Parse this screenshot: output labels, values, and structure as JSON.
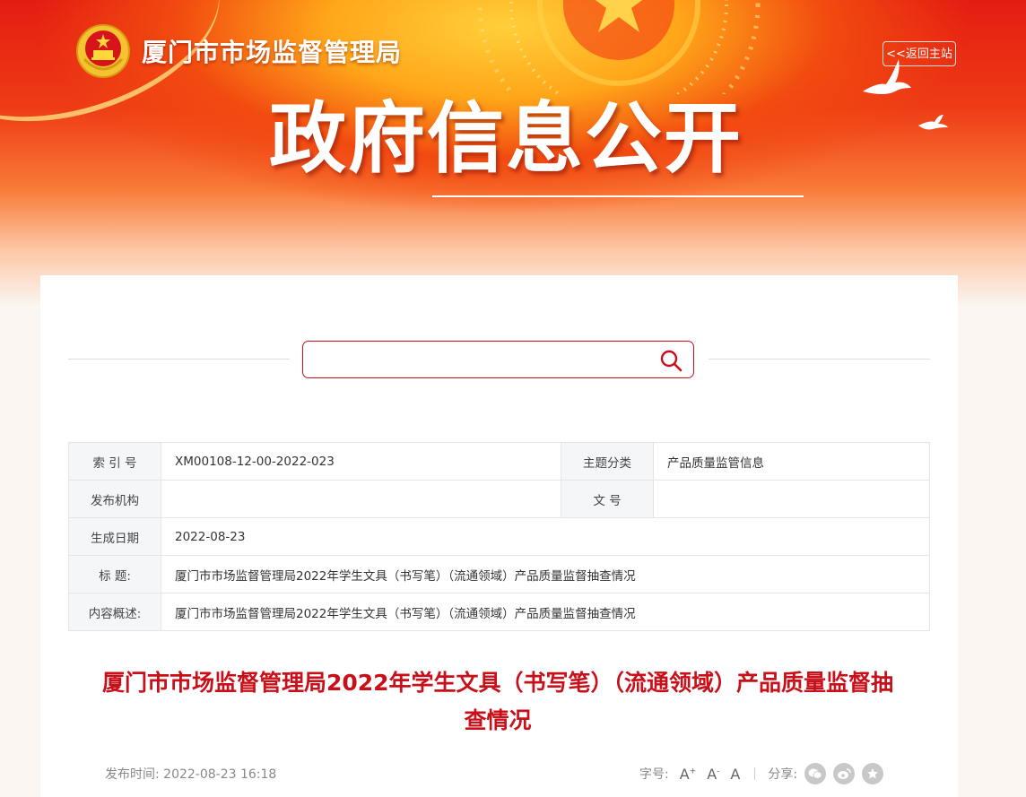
{
  "header": {
    "site_name": "厦门市市场监督管理局",
    "back_link": "<<返回主站",
    "hero_title": "政府信息公开"
  },
  "search": {
    "placeholder": ""
  },
  "info_table": {
    "index_label": "索 引 号",
    "index_value": "XM00108-12-00-2022-023",
    "topic_label": "主题分类",
    "topic_value": "产品质量监管信息",
    "publisher_label": "发布机构",
    "publisher_value": "",
    "docno_label": "文 号",
    "docno_value": "",
    "date_label": "生成日期",
    "date_value": "2022-08-23",
    "title_label": "标 题:",
    "title_value": "厦门市市场监督管理局2022年学生文具（书写笔）（流通领域）产品质量监督抽查情况",
    "summary_label": "内容概述:",
    "summary_value": "厦门市市场监督管理局2022年学生文具（书写笔）（流通领域）产品质量监督抽查情况"
  },
  "article": {
    "title": "厦门市市场监督管理局2022年学生文具（书写笔）（流通领域）产品质量监督抽查情况",
    "publish_label": "发布时间:",
    "publish_time": "2022-08-23 16:18",
    "font_size_label": "字号:",
    "font_large": "A",
    "font_large_mark": "+",
    "font_small": "A",
    "font_small_mark": "-",
    "font_normal": "A",
    "share_label": "分享:"
  },
  "icons": [
    "national-emblem-icon",
    "dove-icon",
    "search-icon",
    "wechat-icon",
    "weibo-icon",
    "favorite-icon"
  ],
  "colors": {
    "accent": "#c8101a",
    "banner_red": "#e41d12",
    "banner_gold": "#ffcf3a"
  }
}
